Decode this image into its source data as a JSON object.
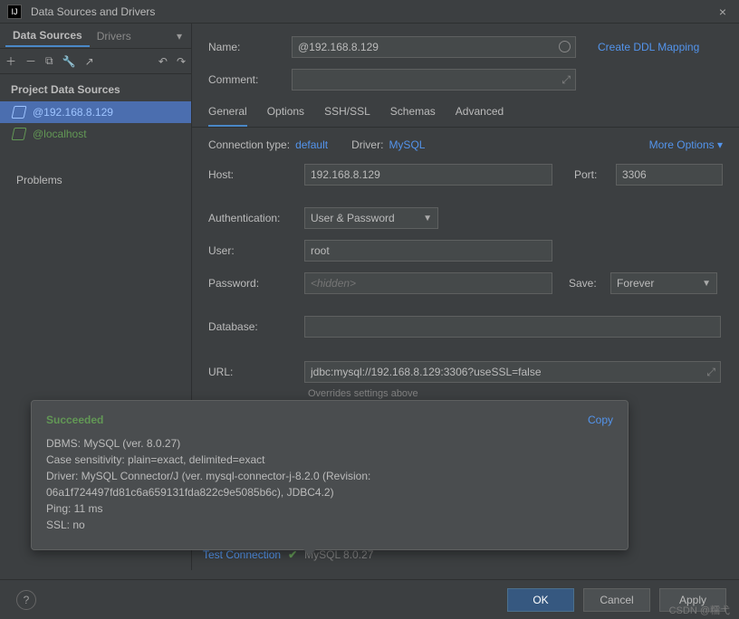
{
  "window": {
    "title": "Data Sources and Drivers"
  },
  "sidebar": {
    "tabs": {
      "sources": "Data Sources",
      "drivers": "Drivers"
    },
    "section": "Project Data Sources",
    "items": [
      {
        "label": "@192.168.8.129",
        "selected": true
      },
      {
        "label": "@localhost",
        "selected": false
      }
    ],
    "problems": "Problems"
  },
  "header": {
    "name_label": "Name:",
    "name_value": "@192.168.8.129",
    "comment_label": "Comment:",
    "ddl_link": "Create DDL Mapping"
  },
  "tabs": {
    "general": "General",
    "options": "Options",
    "ssh": "SSH/SSL",
    "schemas": "Schemas",
    "advanced": "Advanced"
  },
  "connrow": {
    "conn_label": "Connection type:",
    "conn_value": "default",
    "driver_label": "Driver:",
    "driver_value": "MySQL",
    "more": "More Options"
  },
  "form": {
    "host_label": "Host:",
    "host_value": "192.168.8.129",
    "port_label": "Port:",
    "port_value": "3306",
    "auth_label": "Authentication:",
    "auth_value": "User & Password",
    "user_label": "User:",
    "user_value": "root",
    "pass_label": "Password:",
    "pass_placeholder": "<hidden>",
    "save_label": "Save:",
    "save_value": "Forever",
    "db_label": "Database:",
    "db_value": "",
    "url_label": "URL:",
    "url_value": "jdbc:mysql://192.168.8.129:3306?useSSL=false",
    "url_hint": "Overrides settings above"
  },
  "popup": {
    "status": "Succeeded",
    "copy": "Copy",
    "line1": "DBMS: MySQL (ver. 8.0.27)",
    "line2": "Case sensitivity: plain=exact, delimited=exact",
    "line3": "Driver: MySQL Connector/J (ver. mysql-connector-j-8.2.0 (Revision:",
    "line4": "06a1f724497fd81c6a659131fda822c9e5085b6c), JDBC4.2)",
    "line5": "Ping: 11 ms",
    "line6": "SSL: no"
  },
  "test": {
    "label": "Test Connection",
    "version": "MySQL 8.0.27"
  },
  "footer": {
    "ok": "OK",
    "cancel": "Cancel",
    "apply": "Apply"
  },
  "watermark": "CSDN @糯弋"
}
